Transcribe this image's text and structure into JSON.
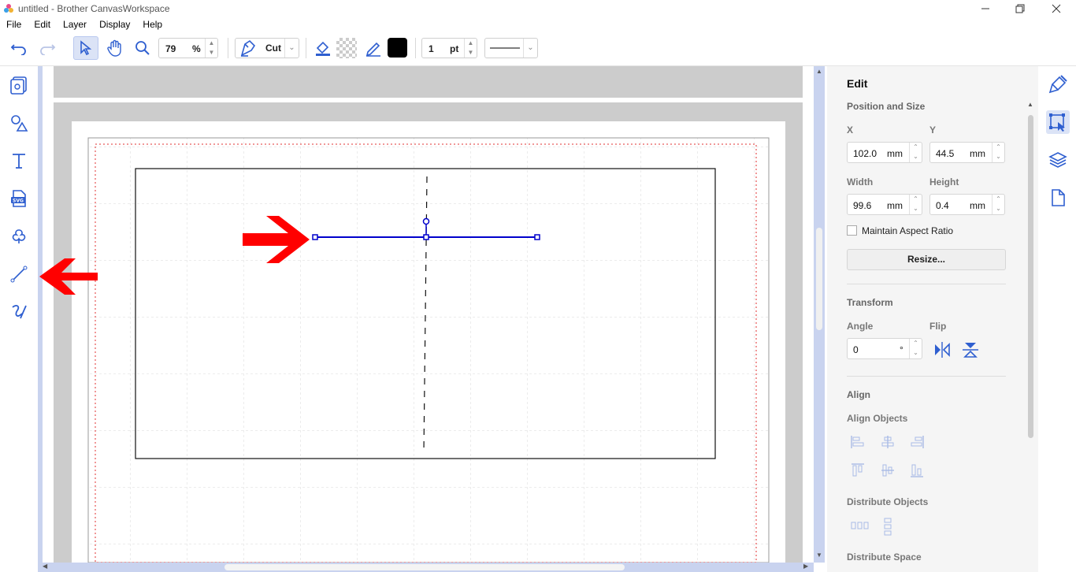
{
  "window": {
    "title": "untitled - Brother CanvasWorkspace",
    "minimize": "—",
    "restore": "❐",
    "close": "✕"
  },
  "menu": [
    "File",
    "Edit",
    "Layer",
    "Display",
    "Help"
  ],
  "toolbar": {
    "zoom_value": "79",
    "zoom_unit": "%",
    "mode_label": "Cut",
    "stroke_width_value": "1",
    "stroke_width_unit": "pt",
    "line_style": "solid",
    "stroke_color": "#000000"
  },
  "left_tools": [
    "template-icon",
    "shapes-icon",
    "text-icon",
    "svg-import-icon",
    "shape-library-icon",
    "line-tool-icon",
    "freehand-icon"
  ],
  "canvas": {
    "selected_line_color": "#0000cc",
    "annotation_color": "#ff0000"
  },
  "panel": {
    "title": "Edit",
    "position_size": {
      "heading": "Position and Size",
      "x_label": "X",
      "x_value": "102.0",
      "x_unit": "mm",
      "y_label": "Y",
      "y_value": "44.5",
      "y_unit": "mm",
      "width_label": "Width",
      "width_value": "99.6",
      "width_unit": "mm",
      "height_label": "Height",
      "height_value": "0.4",
      "height_unit": "mm",
      "maintain_aspect": "Maintain Aspect Ratio",
      "maintain_aspect_checked": false,
      "resize_button": "Resize..."
    },
    "transform": {
      "heading": "Transform",
      "angle_label": "Angle",
      "angle_value": "0",
      "angle_unit": "°",
      "flip_label": "Flip"
    },
    "align": {
      "heading": "Align",
      "align_objects": "Align Objects",
      "distribute_objects": "Distribute Objects",
      "distribute_space": "Distribute Space"
    }
  },
  "right_icons": [
    "paint-icon",
    "edit-select-icon",
    "layers-icon",
    "page-icon"
  ],
  "accent": "#2f5fd0"
}
